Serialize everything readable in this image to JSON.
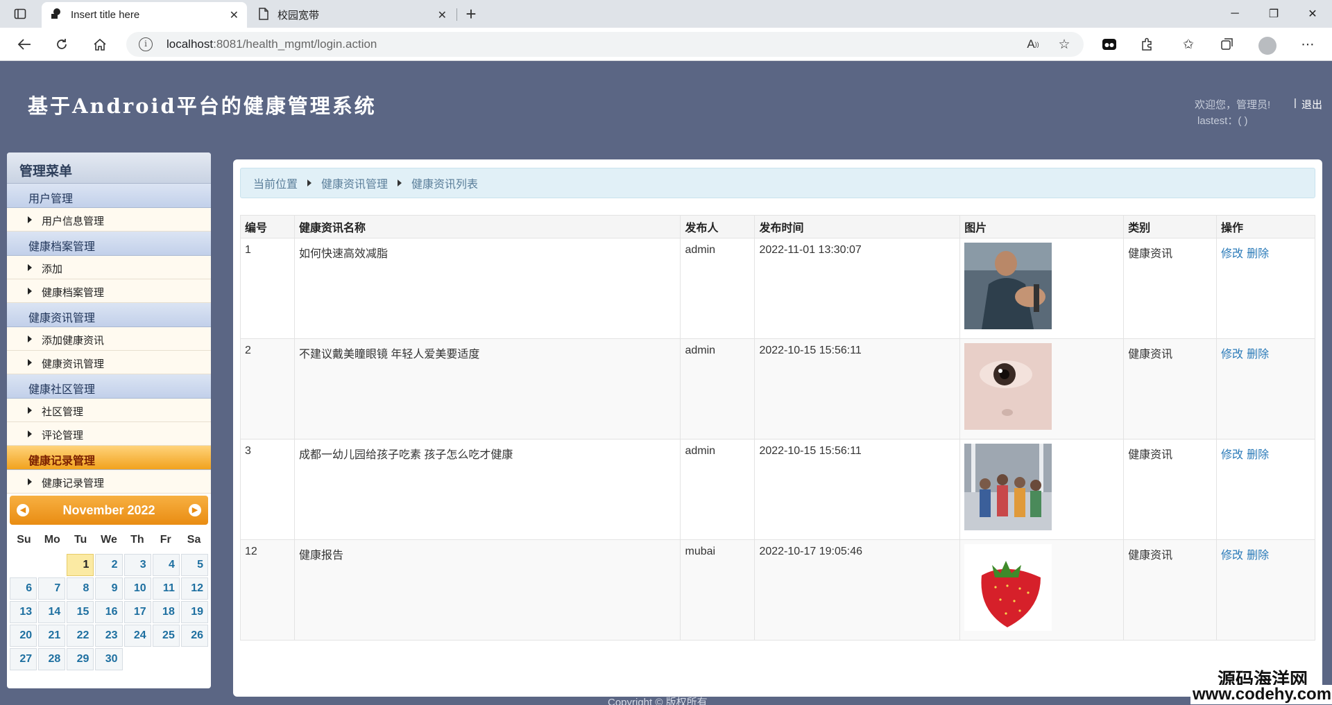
{
  "browser": {
    "tabs": [
      {
        "title": "Insert title here",
        "active": true
      },
      {
        "title": "校园宽带",
        "active": false
      }
    ],
    "new_tab": "+",
    "url_host": "localhost",
    "url_rest": ":8081/health_mgmt/login.action",
    "window": {
      "minimize": "─",
      "restore": "❐",
      "close": "✕"
    }
  },
  "header": {
    "title": "基于Android平台的健康管理系统",
    "welcome": "欢迎您，管理员!",
    "sep": "|",
    "logout": "退出",
    "lastest": "lastest：( )"
  },
  "sidebar": {
    "head": "管理菜单",
    "groups": [
      {
        "label": "用户管理",
        "items": [
          "用户信息管理"
        ]
      },
      {
        "label": "健康档案管理",
        "items": [
          "添加",
          "健康档案管理"
        ]
      },
      {
        "label": "健康资讯管理",
        "items": [
          "添加健康资讯",
          "健康资讯管理"
        ]
      },
      {
        "label": "健康社区管理",
        "items": [
          "社区管理",
          "评论管理"
        ]
      },
      {
        "label": "健康记录管理",
        "items": [
          "健康记录管理"
        ],
        "active": true
      }
    ]
  },
  "calendar": {
    "title": "November 2022",
    "dow": [
      "Su",
      "Mo",
      "Tu",
      "We",
      "Th",
      "Fr",
      "Sa"
    ],
    "leading_blanks": 2,
    "days": [
      "1",
      "2",
      "3",
      "4",
      "5",
      "6",
      "7",
      "8",
      "9",
      "10",
      "11",
      "12",
      "13",
      "14",
      "15",
      "16",
      "17",
      "18",
      "19",
      "20",
      "21",
      "22",
      "23",
      "24",
      "25",
      "26",
      "27",
      "28",
      "29",
      "30"
    ],
    "today": "1"
  },
  "breadcrumb": [
    "当前位置",
    "健康资讯管理",
    "健康资讯列表"
  ],
  "table": {
    "headers": [
      "编号",
      "健康资讯名称",
      "发布人",
      "发布时间",
      "图片",
      "类别",
      "操作"
    ],
    "rows": [
      {
        "id": "1",
        "name": "如何快速高效减脂",
        "author": "admin",
        "time": "2022-11-01 13:30:07",
        "image": "fitness-photo",
        "category": "健康资讯",
        "edit": "修改",
        "delete": "删除"
      },
      {
        "id": "2",
        "name": "不建议戴美瞳眼镜 年轻人爱美要适度",
        "author": "admin",
        "time": "2022-10-15 15:56:11",
        "image": "eye-photo",
        "category": "健康资讯",
        "edit": "修改",
        "delete": "删除"
      },
      {
        "id": "3",
        "name": "成都一幼儿园给孩子吃素 孩子怎么吃才健康",
        "author": "admin",
        "time": "2022-10-15 15:56:11",
        "image": "children-photo",
        "category": "健康资讯",
        "edit": "修改",
        "delete": "删除"
      },
      {
        "id": "12",
        "name": "健康报告",
        "author": "mubai",
        "time": "2022-10-17 19:05:46",
        "image": "strawberry-photo",
        "category": "健康资讯",
        "edit": "修改",
        "delete": "删除"
      }
    ]
  },
  "footer": "Copyright © 版权所有",
  "watermark": {
    "line1": "源码海洋网",
    "line2": "www.codehy.com"
  }
}
